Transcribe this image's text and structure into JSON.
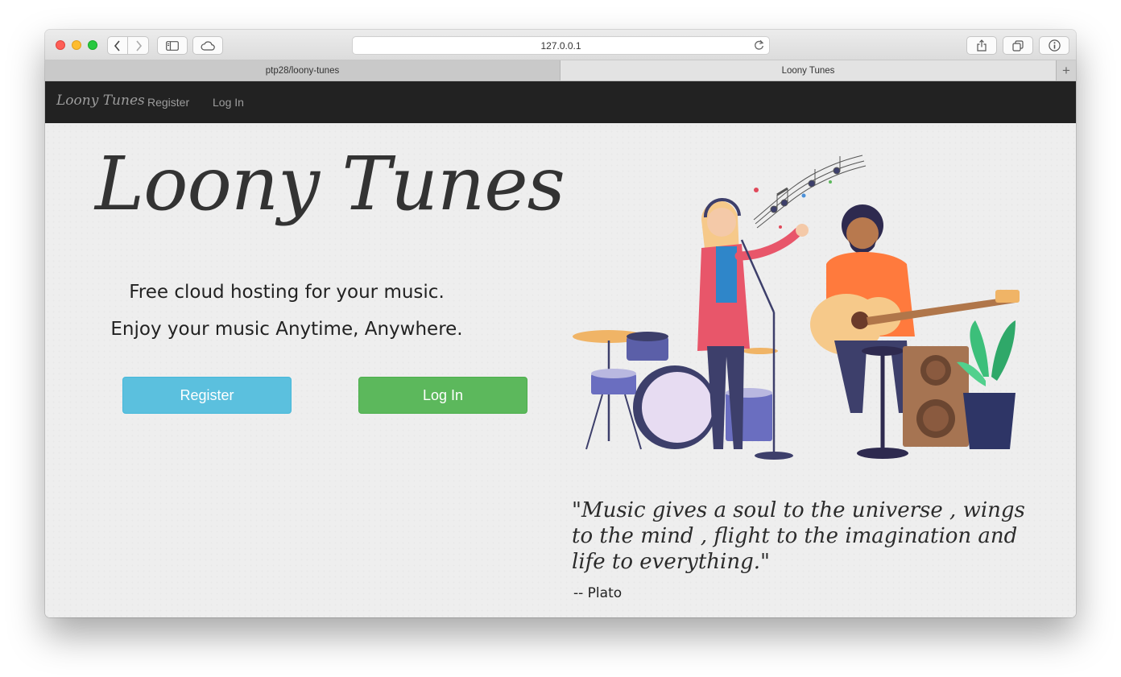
{
  "browser": {
    "url": "127.0.0.1",
    "tabs": [
      {
        "label": "ptp28/loony-tunes",
        "active": false
      },
      {
        "label": "Loony Tunes",
        "active": true
      }
    ],
    "new_tab_symbol": "+"
  },
  "navbar": {
    "brand": "Loony Tunes",
    "links": [
      "Register",
      "Log In"
    ]
  },
  "hero": {
    "title": "Loony Tunes",
    "tagline1": "Free cloud hosting for your music.",
    "tagline2": "Enjoy your music Anytime, Anywhere.",
    "register_button": "Register",
    "login_button": "Log In"
  },
  "quote": {
    "text": "\"Music gives a soul to the universe , wings to the mind , flight to the imagination and life to everything.\"",
    "author": "-- Plato"
  },
  "colors": {
    "navbar_bg": "#222222",
    "register": "#5bc0de",
    "login": "#5cb85c"
  },
  "icons": [
    "back-icon",
    "forward-icon",
    "sidebar-icon",
    "cloud-icon",
    "reload-icon",
    "share-icon",
    "tabs-overview-icon",
    "info-icon"
  ]
}
